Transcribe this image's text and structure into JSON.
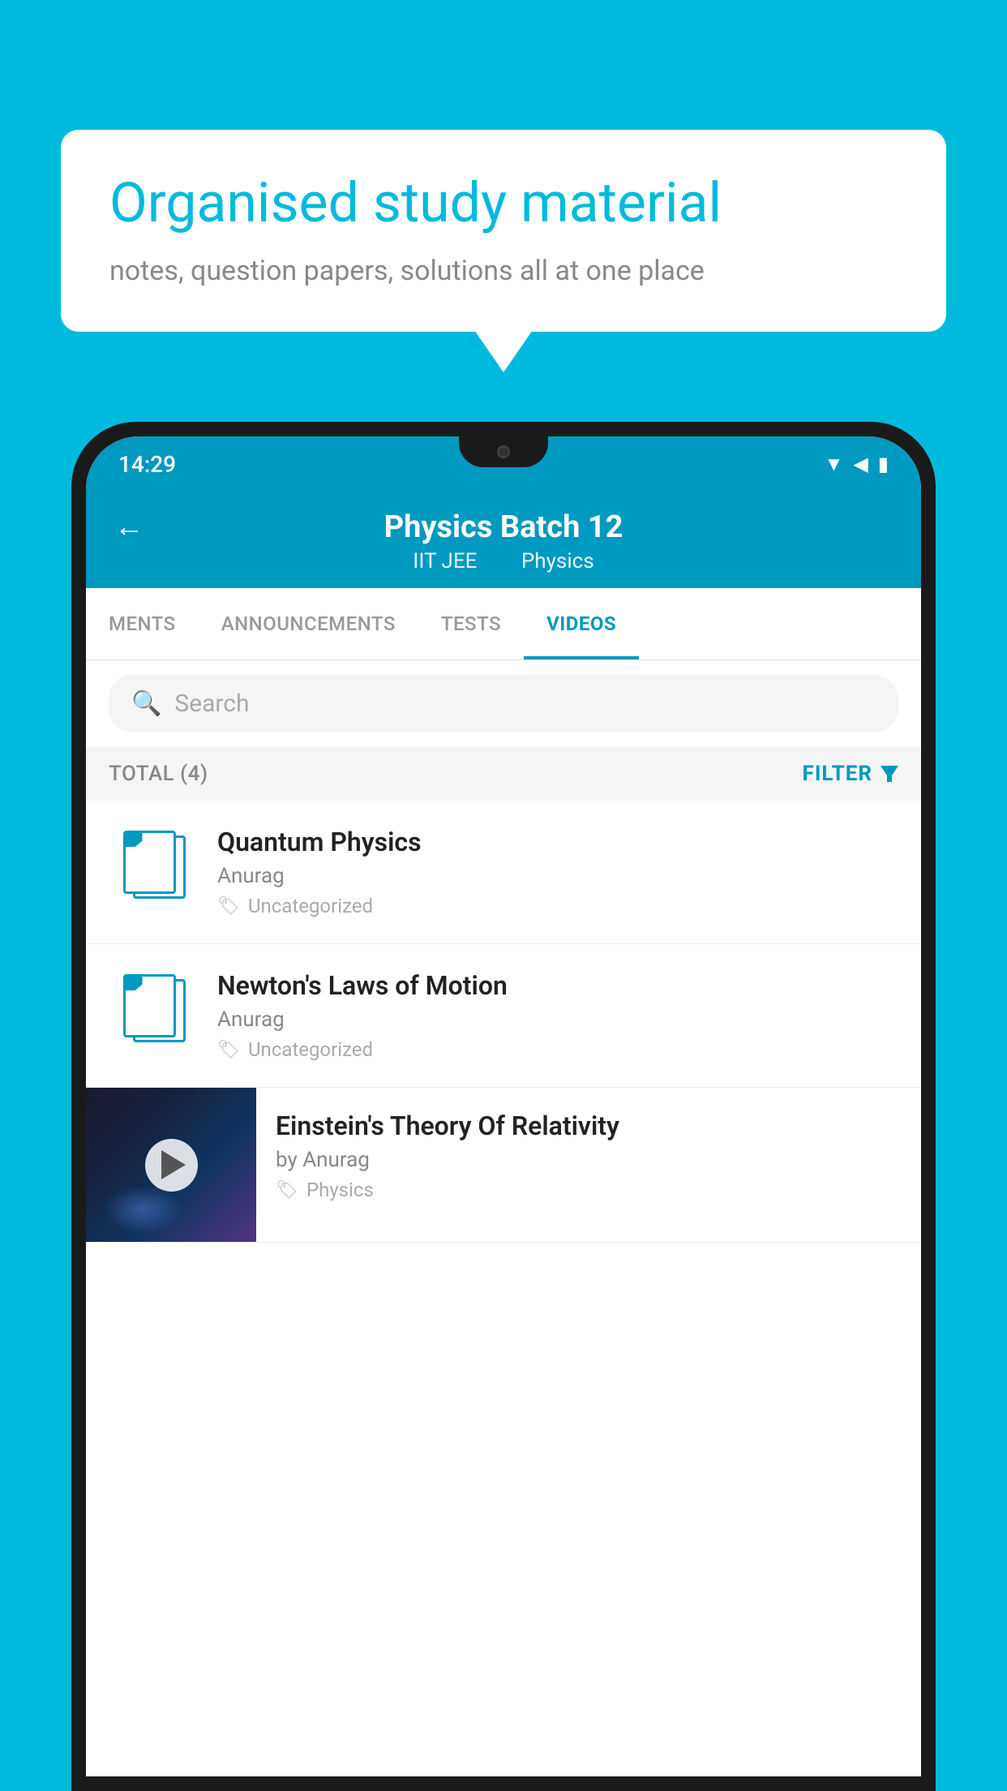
{
  "background_color": "#00BADD",
  "speech_bubble": {
    "title": "Organised study material",
    "subtitle": "notes, question papers, solutions all at one place"
  },
  "phone": {
    "status_bar": {
      "time": "14:29",
      "wifi_icon": "wifi",
      "signal_icon": "signal",
      "battery_icon": "battery"
    },
    "header": {
      "back_label": "←",
      "title": "Physics Batch 12",
      "subtitle_tag1": "IIT JEE",
      "subtitle_tag2": "Physics"
    },
    "tabs": [
      {
        "label": "MENTS",
        "active": false
      },
      {
        "label": "ANNOUNCEMENTS",
        "active": false
      },
      {
        "label": "TESTS",
        "active": false
      },
      {
        "label": "VIDEOS",
        "active": true
      }
    ],
    "search": {
      "placeholder": "Search"
    },
    "filter": {
      "total_label": "TOTAL (4)",
      "filter_label": "FILTER"
    },
    "videos": [
      {
        "id": 1,
        "title": "Quantum Physics",
        "author": "Anurag",
        "tag": "Uncategorized",
        "has_thumbnail": false
      },
      {
        "id": 2,
        "title": "Newton's Laws of Motion",
        "author": "Anurag",
        "tag": "Uncategorized",
        "has_thumbnail": false
      },
      {
        "id": 3,
        "title": "Einstein's Theory Of Relativity",
        "author": "by Anurag",
        "tag": "Physics",
        "has_thumbnail": true
      }
    ]
  }
}
